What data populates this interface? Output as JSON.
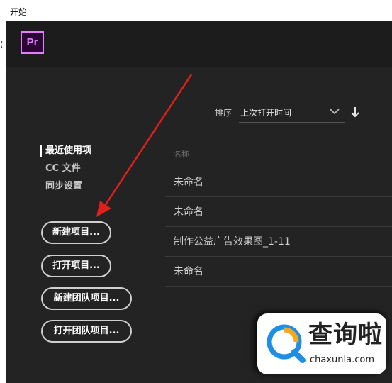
{
  "window": {
    "title": "开始",
    "left_edge_text": "("
  },
  "header": {
    "logo_text": "Pr"
  },
  "sidebar": {
    "items": [
      {
        "label": "最近使用项",
        "active": true
      },
      {
        "label": "CC 文件",
        "active": false
      },
      {
        "label": "同步设置",
        "active": false
      }
    ]
  },
  "buttons": {
    "new_project": "新建项目...",
    "open_project": "打开项目...",
    "new_team_project": "新建团队项目...",
    "open_team_project": "打开团队项目..."
  },
  "sort": {
    "label": "排序",
    "value": "上次打开时间",
    "dropdown_icon": "chevron-down-icon",
    "direction_icon": "arrow-down-icon"
  },
  "file_list": {
    "column_header": "名称",
    "rows": [
      "未命名",
      "未命名",
      "制作公益广告效果图_1-11",
      "未命名"
    ]
  },
  "annotation": {
    "arrow_color": "#e0201b"
  },
  "watermark": {
    "name": "查询啦",
    "url": "chaxunla.com",
    "icon": "magnifier-logo-icon"
  },
  "colors": {
    "panel_bg": "#232323",
    "header_bg": "#1c1c1c",
    "pr_accent": "#e77cff",
    "pr_bg": "#2a0634"
  }
}
